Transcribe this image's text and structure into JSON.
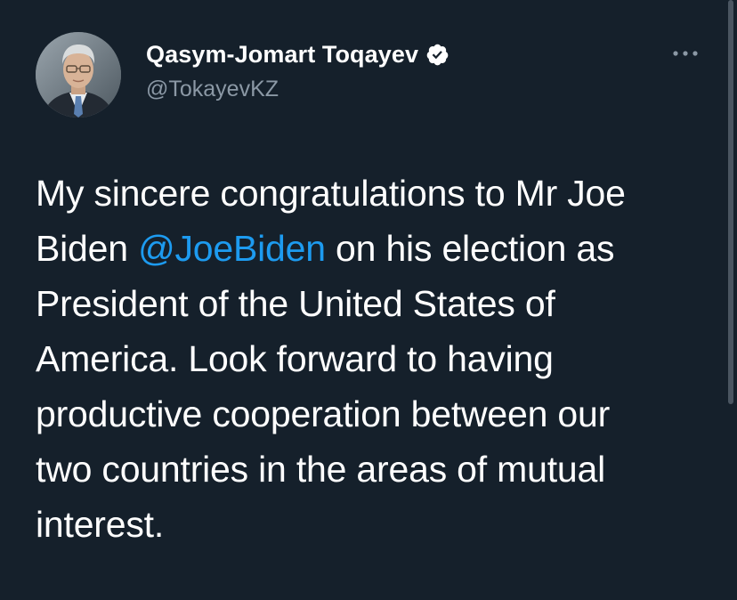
{
  "theme": {
    "background": "#15202b",
    "text": "#ffffff",
    "secondary_text": "#8b98a5",
    "link": "#1d9bf0",
    "verified_badge": "#ffffff"
  },
  "author": {
    "display_name": "Qasym-Jomart Toqayev",
    "handle": "@TokayevKZ",
    "verified": true,
    "verified_icon": "verified-badge-icon",
    "avatar_icon": "profile-photo"
  },
  "more_menu": {
    "icon": "more-horizontal-icon"
  },
  "tweet": {
    "line_1": "My sincere congratulations to Mr Joe",
    "line_2_before": "Biden ",
    "mention": "@JoeBiden",
    "line_2_after": " on his election as",
    "line_3": "President of the United States of",
    "line_4": "America. Look forward to having",
    "line_5": "productive cooperation between our",
    "line_6": "two countries in the areas of mutual",
    "line_7": "interest."
  }
}
